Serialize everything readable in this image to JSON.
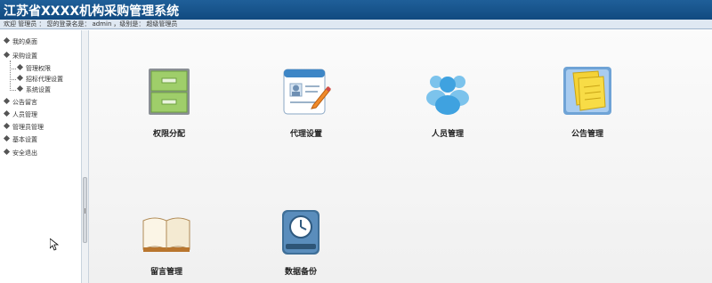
{
  "header": {
    "title": "江苏省XXXX机构采购管理系统"
  },
  "infobar": {
    "welcome": "欢迎 管理员 ：",
    "login_label": "您的登录名是：",
    "login_name": "admin",
    "level_label": "，级别是：",
    "level_value": "超级管理员"
  },
  "sidebar": {
    "items": [
      {
        "label": "我的桌面",
        "level": 0
      },
      {
        "label": "采购设置",
        "level": 0
      },
      {
        "label": "管理权限",
        "level": 1
      },
      {
        "label": "招标代理设置",
        "level": 1
      },
      {
        "label": "系统设置",
        "level": 1
      },
      {
        "label": "公告留言",
        "level": 0
      },
      {
        "label": "人员管理",
        "level": 0
      },
      {
        "label": "管理员管理",
        "level": 0
      },
      {
        "label": "基本设置",
        "level": 0
      },
      {
        "label": "安全退出",
        "level": 0
      }
    ]
  },
  "tiles": [
    {
      "label": "权限分配",
      "icon": "cabinet-icon"
    },
    {
      "label": "代理设置",
      "icon": "profile-card-icon"
    },
    {
      "label": "人员管理",
      "icon": "users-icon"
    },
    {
      "label": "公告管理",
      "icon": "notes-icon"
    },
    {
      "label": "留言管理",
      "icon": "book-icon"
    },
    {
      "label": "数据备份",
      "icon": "backup-drive-icon"
    }
  ],
  "colors": {
    "header": "#1f5f99",
    "infobar": "#dfe8f2"
  }
}
